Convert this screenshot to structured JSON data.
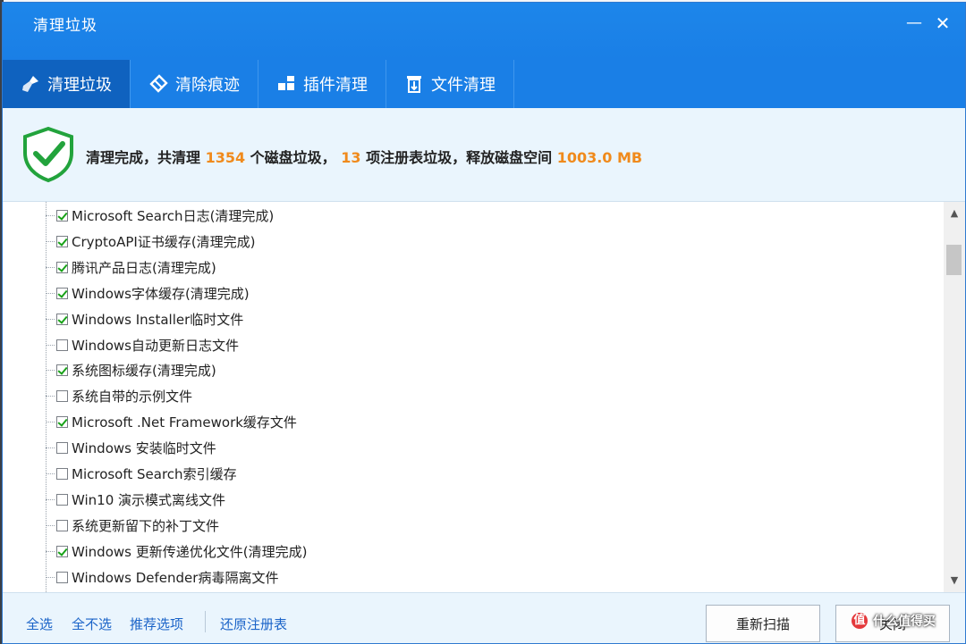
{
  "window": {
    "title": "清理垃圾",
    "minimize_icon": "minimize-icon",
    "close_icon": "close-icon"
  },
  "tabs": [
    {
      "label": "清理垃圾",
      "icon": "broom-icon",
      "active": true
    },
    {
      "label": "清除痕迹",
      "icon": "eraser-icon",
      "active": false
    },
    {
      "label": "插件清理",
      "icon": "puzzle-icon",
      "active": false
    },
    {
      "label": "文件清理",
      "icon": "file-cleanup-icon",
      "active": false
    }
  ],
  "summary": {
    "icon": "shield-check-icon",
    "prefix": "清理完成，共清理 ",
    "disk_count": "1354",
    "mid1": " 个磁盘垃圾， ",
    "registry_count": "13",
    "mid2": " 项注册表垃圾，释放磁盘空间 ",
    "freed": "1003.0 MB",
    "accent_color": "#f08a1c"
  },
  "items": [
    {
      "label": "Microsoft Search日志(清理完成)",
      "checked": true
    },
    {
      "label": "CryptoAPI证书缓存(清理完成)",
      "checked": true
    },
    {
      "label": "腾讯产品日志(清理完成)",
      "checked": true
    },
    {
      "label": "Windows字体缓存(清理完成)",
      "checked": true
    },
    {
      "label": "Windows Installer临时文件",
      "checked": true
    },
    {
      "label": "Windows自动更新日志文件",
      "checked": false
    },
    {
      "label": "系统图标缓存(清理完成)",
      "checked": true
    },
    {
      "label": "系统自带的示例文件",
      "checked": false
    },
    {
      "label": "Microsoft .Net Framework缓存文件",
      "checked": true
    },
    {
      "label": "Windows 安装临时文件",
      "checked": false
    },
    {
      "label": "Microsoft Search索引缓存",
      "checked": false
    },
    {
      "label": "Win10 演示模式离线文件",
      "checked": false
    },
    {
      "label": "系统更新留下的补丁文件",
      "checked": false
    },
    {
      "label": "Windows 更新传递优化文件(清理完成)",
      "checked": true
    },
    {
      "label": "Windows Defender病毒隔离文件",
      "checked": false
    }
  ],
  "footer": {
    "select_all": "全选",
    "select_none": "全不选",
    "recommended": "推荐选项",
    "restore_registry": "还原注册表",
    "rescan": "重新扫描",
    "close": "关闭"
  },
  "watermark": {
    "text": "什么值得买",
    "logo": "值"
  }
}
